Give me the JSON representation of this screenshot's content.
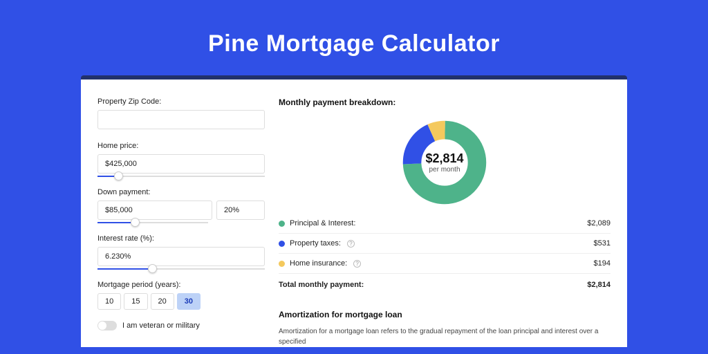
{
  "title": "Pine Mortgage Calculator",
  "form": {
    "zip": {
      "label": "Property Zip Code:",
      "value": ""
    },
    "home_price": {
      "label": "Home price:",
      "value": "$425,000",
      "slider_pct": 10
    },
    "down_payment": {
      "label": "Down payment:",
      "value": "$85,000",
      "pct_value": "20%",
      "slider_pct": 20
    },
    "interest_rate": {
      "label": "Interest rate (%):",
      "value": "6.230%",
      "slider_pct": 30
    },
    "mortgage_period": {
      "label": "Mortgage period (years):",
      "options": [
        "10",
        "15",
        "20",
        "30"
      ],
      "active": "30"
    },
    "veteran": {
      "label": "I am veteran or military",
      "on": false
    }
  },
  "breakdown": {
    "title": "Monthly payment breakdown:",
    "center_amount": "$2,814",
    "center_sub": "per month",
    "items": [
      {
        "label": "Principal & Interest:",
        "value": "$2,089",
        "color": "green",
        "help": false
      },
      {
        "label": "Property taxes:",
        "value": "$531",
        "color": "blue",
        "help": true
      },
      {
        "label": "Home insurance:",
        "value": "$194",
        "color": "yellow",
        "help": true
      }
    ],
    "total": {
      "label": "Total monthly payment:",
      "value": "$2,814"
    }
  },
  "amortization": {
    "title": "Amortization for mortgage loan",
    "text": "Amortization for a mortgage loan refers to the gradual repayment of the loan principal and interest over a specified"
  },
  "chart_data": {
    "type": "pie",
    "title": "Monthly payment breakdown",
    "series": [
      {
        "name": "Principal & Interest",
        "value": 2089,
        "color": "#4eb38a"
      },
      {
        "name": "Property taxes",
        "value": 531,
        "color": "#3050e6"
      },
      {
        "name": "Home insurance",
        "value": 194,
        "color": "#f4c95d"
      }
    ],
    "total": 2814,
    "unit": "$/month"
  }
}
